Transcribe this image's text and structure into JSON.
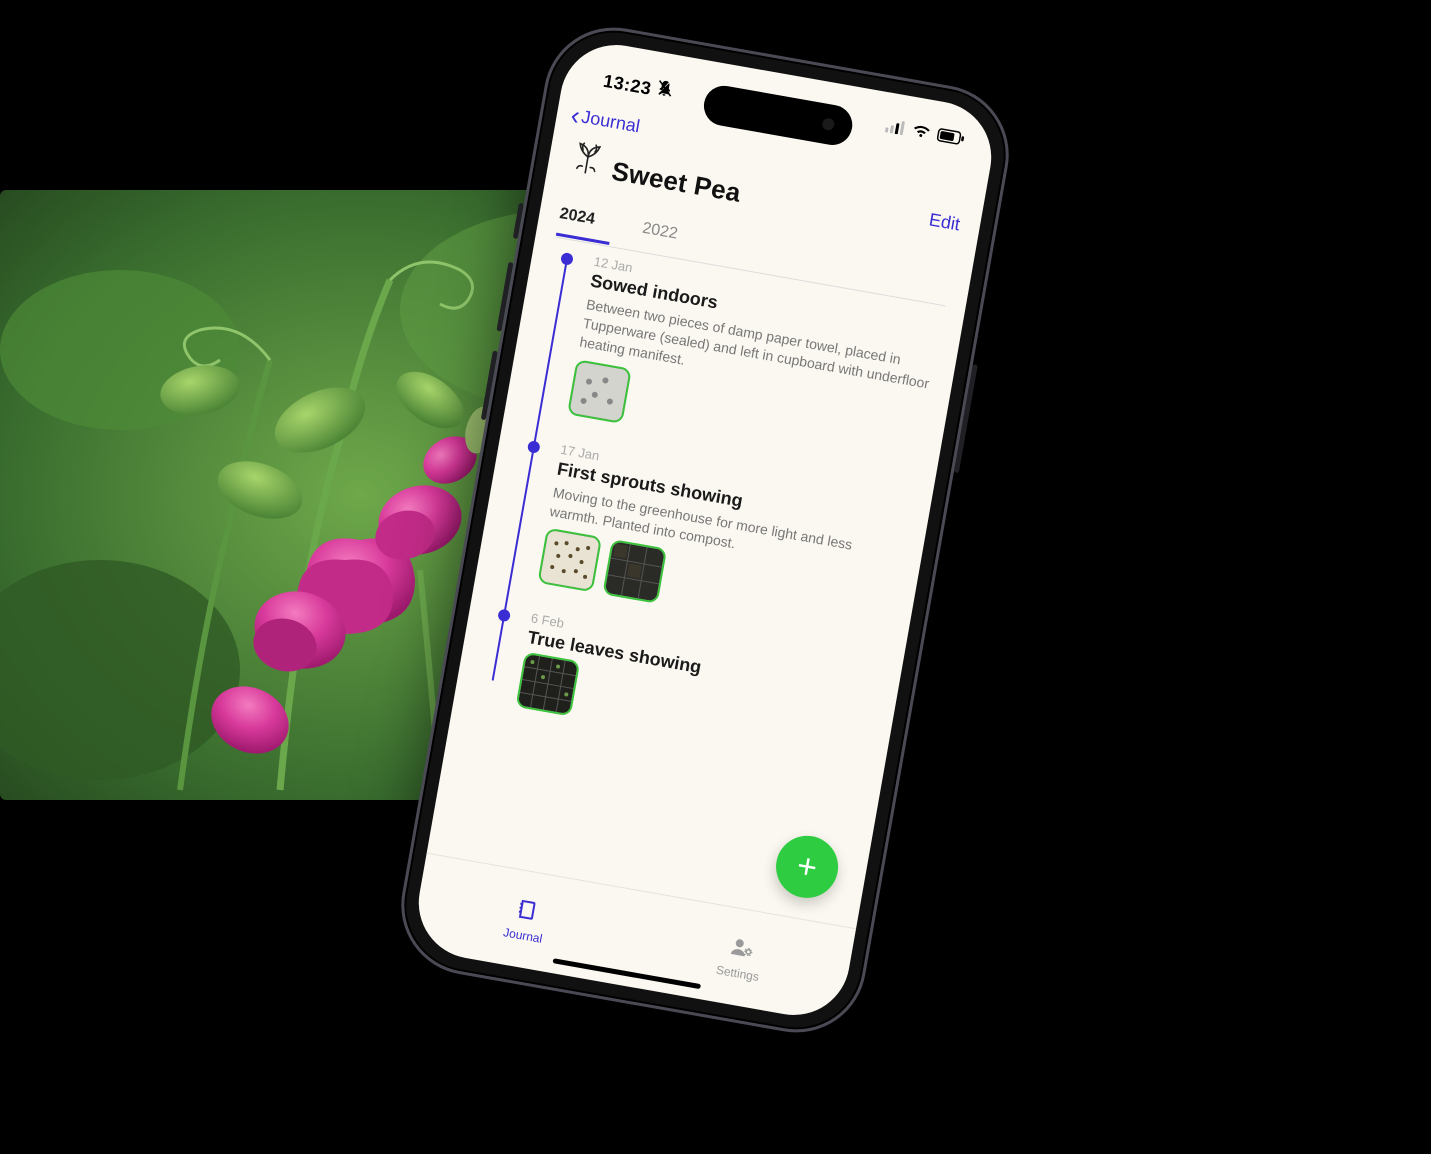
{
  "status": {
    "time": "13:23"
  },
  "nav": {
    "back_label": "Journal",
    "edit_label": "Edit"
  },
  "header": {
    "title": "Sweet Pea"
  },
  "tabs": [
    "2024",
    "2022"
  ],
  "timeline": [
    {
      "date": "12 Jan",
      "title": "Sowed indoors",
      "body": "Between two pieces of damp paper towel, placed in Tupperware (sealed) and left in cupboard with underfloor heating manifest.",
      "thumbs": 1
    },
    {
      "date": "17 Jan",
      "title": "First sprouts showing",
      "body": "Moving to the greenhouse for more light and less warmth. Planted into compost.",
      "thumbs": 2
    },
    {
      "date": "6 Feb",
      "title": "True leaves showing",
      "body": "",
      "thumbs": 1
    }
  ],
  "tabbar": {
    "journal": "Journal",
    "settings": "Settings"
  }
}
